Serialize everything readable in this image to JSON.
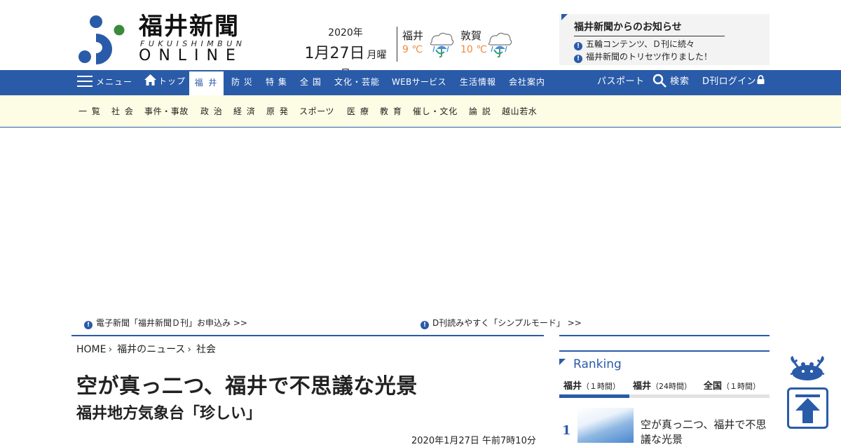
{
  "header": {
    "logo_title": "福井新聞",
    "logo_sub": "FUKUISHIMBUN",
    "logo_online": "ONLINE",
    "date_year": "2020年",
    "date_day": "1月27日",
    "date_dow": "月曜日",
    "weather": [
      {
        "city": "福井",
        "temp": "9 ℃",
        "icon": "rain-umbrella-icon"
      },
      {
        "city": "敦賀",
        "temp": "10 ℃",
        "icon": "rain-umbrella-icon"
      }
    ],
    "notice": {
      "title": "福井新聞からのお知らせ",
      "items": [
        "五輪コンテンツ、Ｄ刊に続々",
        "福井新聞のトリセツ作りました！"
      ]
    }
  },
  "nav": {
    "menu_label": "メニュー",
    "top_label": "トップ",
    "active_label": "福 井",
    "items": [
      "防 災",
      "特 集",
      "全 国",
      "文化・芸能",
      "WEBサービス",
      "生活情報",
      "会社案内"
    ],
    "passport": "パスポート",
    "search": "検索",
    "login": "D刊ログイン"
  },
  "subnav": {
    "items": [
      "一 覧",
      "社 会",
      "事件・事故",
      "政 治",
      "経 済",
      "原 発",
      "スポーツ",
      "医 療",
      "教 育",
      "催し・文化",
      "論 説",
      "越山若水"
    ]
  },
  "promo": [
    "電子新聞「福井新聞Ｄ刊」お申込み >>",
    "D刊読みやすく「シンプルモード」 >>"
  ],
  "breadcrumb": [
    "HOME",
    "福井のニュース",
    "社会"
  ],
  "article": {
    "headline": "空が真っ二つ、福井で不思議な光景",
    "subheadline": "福井地方気象台「珍しい」",
    "date": "2020年1月27日 午前7時10分"
  },
  "ranking": {
    "title": "Ranking",
    "tabs": [
      {
        "label": "福井",
        "period": "（１時間）"
      },
      {
        "label": "福井",
        "period": "（24時間）"
      },
      {
        "label": "全国",
        "period": "（１時間）"
      }
    ],
    "active_tab": 0,
    "items": [
      {
        "rank": "1",
        "text": "空が真っ二つ、福井で不思議な光景"
      }
    ]
  },
  "colors": {
    "brand_blue": "#2a5ba8",
    "subnav_bg": "#fdfce4",
    "temp_orange": "#f08a3c"
  }
}
